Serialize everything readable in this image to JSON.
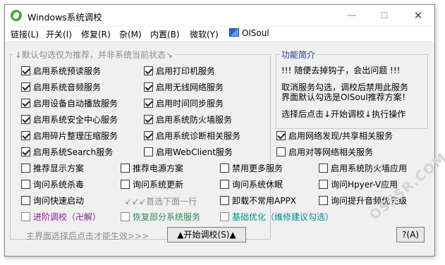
{
  "window": {
    "title": "Windows系统调校",
    "controls": {
      "minimize": "—",
      "maximize": "☐",
      "close": "✕"
    }
  },
  "menu": [
    {
      "label": "链接(L)"
    },
    {
      "label": "开关(I)"
    },
    {
      "label": "修复(R)"
    },
    {
      "label": "杂(M)"
    },
    {
      "label": "内置(B)"
    },
    {
      "label": "微软(Y)"
    },
    {
      "label": "OlSoul",
      "icon": "computer-icon"
    }
  ],
  "options_group": {
    "title": "↓默认勾选仅为推荐，并非系统当前状态↘"
  },
  "checkboxes": {
    "c1": {
      "label": "启用系统预读服务",
      "checked": true
    },
    "c2": {
      "label": "启用打印机服务",
      "checked": true
    },
    "c3": {
      "label": "启用系统音频服务",
      "checked": true
    },
    "c4": {
      "label": "启用无线网络服务",
      "checked": true
    },
    "c5": {
      "label": "启用设备自动播放服务",
      "checked": true
    },
    "c6": {
      "label": "启用时间同步服务",
      "checked": true
    },
    "c7": {
      "label": "启用系统安全中心服务",
      "checked": true
    },
    "c8": {
      "label": "启用系统防火墙服务",
      "checked": true
    },
    "c9": {
      "label": "启用碎片整理压缩服务",
      "checked": true
    },
    "c10": {
      "label": "启用系统诊断相关服务",
      "checked": true
    },
    "c11": {
      "label": "启用网络发现/共享相关服务",
      "checked": true
    },
    "c12": {
      "label": "启用系统Search服务",
      "checked": true
    },
    "c13": {
      "label": "启用WebClient服务",
      "checked": false
    },
    "c14": {
      "label": "启用对等网络相关服务",
      "checked": false
    },
    "c15": {
      "label": "推荐显示方案",
      "checked": false
    },
    "c16": {
      "label": "推荐电源方案",
      "checked": false
    },
    "c17": {
      "label": "禁用更多服务",
      "checked": false
    },
    "c18": {
      "label": "启用系统防火墙应用",
      "checked": false
    },
    "c19": {
      "label": "询问系统杀毒",
      "checked": false
    },
    "c20": {
      "label": "询问系统更新",
      "checked": false
    },
    "c21": {
      "label": "询问系统休眠",
      "checked": false
    },
    "c22": {
      "label": "询问Hpyer-V应用",
      "checked": false
    },
    "c23": {
      "label": "询问快速启动",
      "checked": false
    },
    "c24": {
      "label": "卸载不常用APPX",
      "checked": false
    },
    "c25": {
      "label": "询问提升音频优先级",
      "checked": false
    },
    "c26": {
      "label": "进阶调校（卍解）",
      "checked": false,
      "color": "#8b1a9c"
    },
    "c27": {
      "label": "恢复部分系统服务",
      "checked": false,
      "color": "#2e8b57"
    },
    "c28": {
      "label": "基础优化（维修建议勾选）",
      "checked": false,
      "color": "#008b8b"
    }
  },
  "hint_first_row": "↙↙↙首选下面一行",
  "info": {
    "title": "功能简介",
    "lines": [
      "!!! 随便去掉钩子，会出问题 !!!",
      "取消服务勾选，调校后禁用此服务",
      "界面默认勾选是OlSoul推荐方案！",
      "选择后点击↓开始调校↓执行操作"
    ]
  },
  "footer": {
    "hint": "主界面选择后点击才能生效>>>",
    "start_button": "▲开始调校(S)▲",
    "help_button": "?(A)"
  },
  "watermark": "OSSSR.COM",
  "colors": {
    "info_title": "#1e3a8a",
    "hint_grey": "#8a8a8a",
    "advanced_purple": "#8b1a9c",
    "restore_green": "#2e8b57",
    "basic_teal": "#008b8b"
  }
}
